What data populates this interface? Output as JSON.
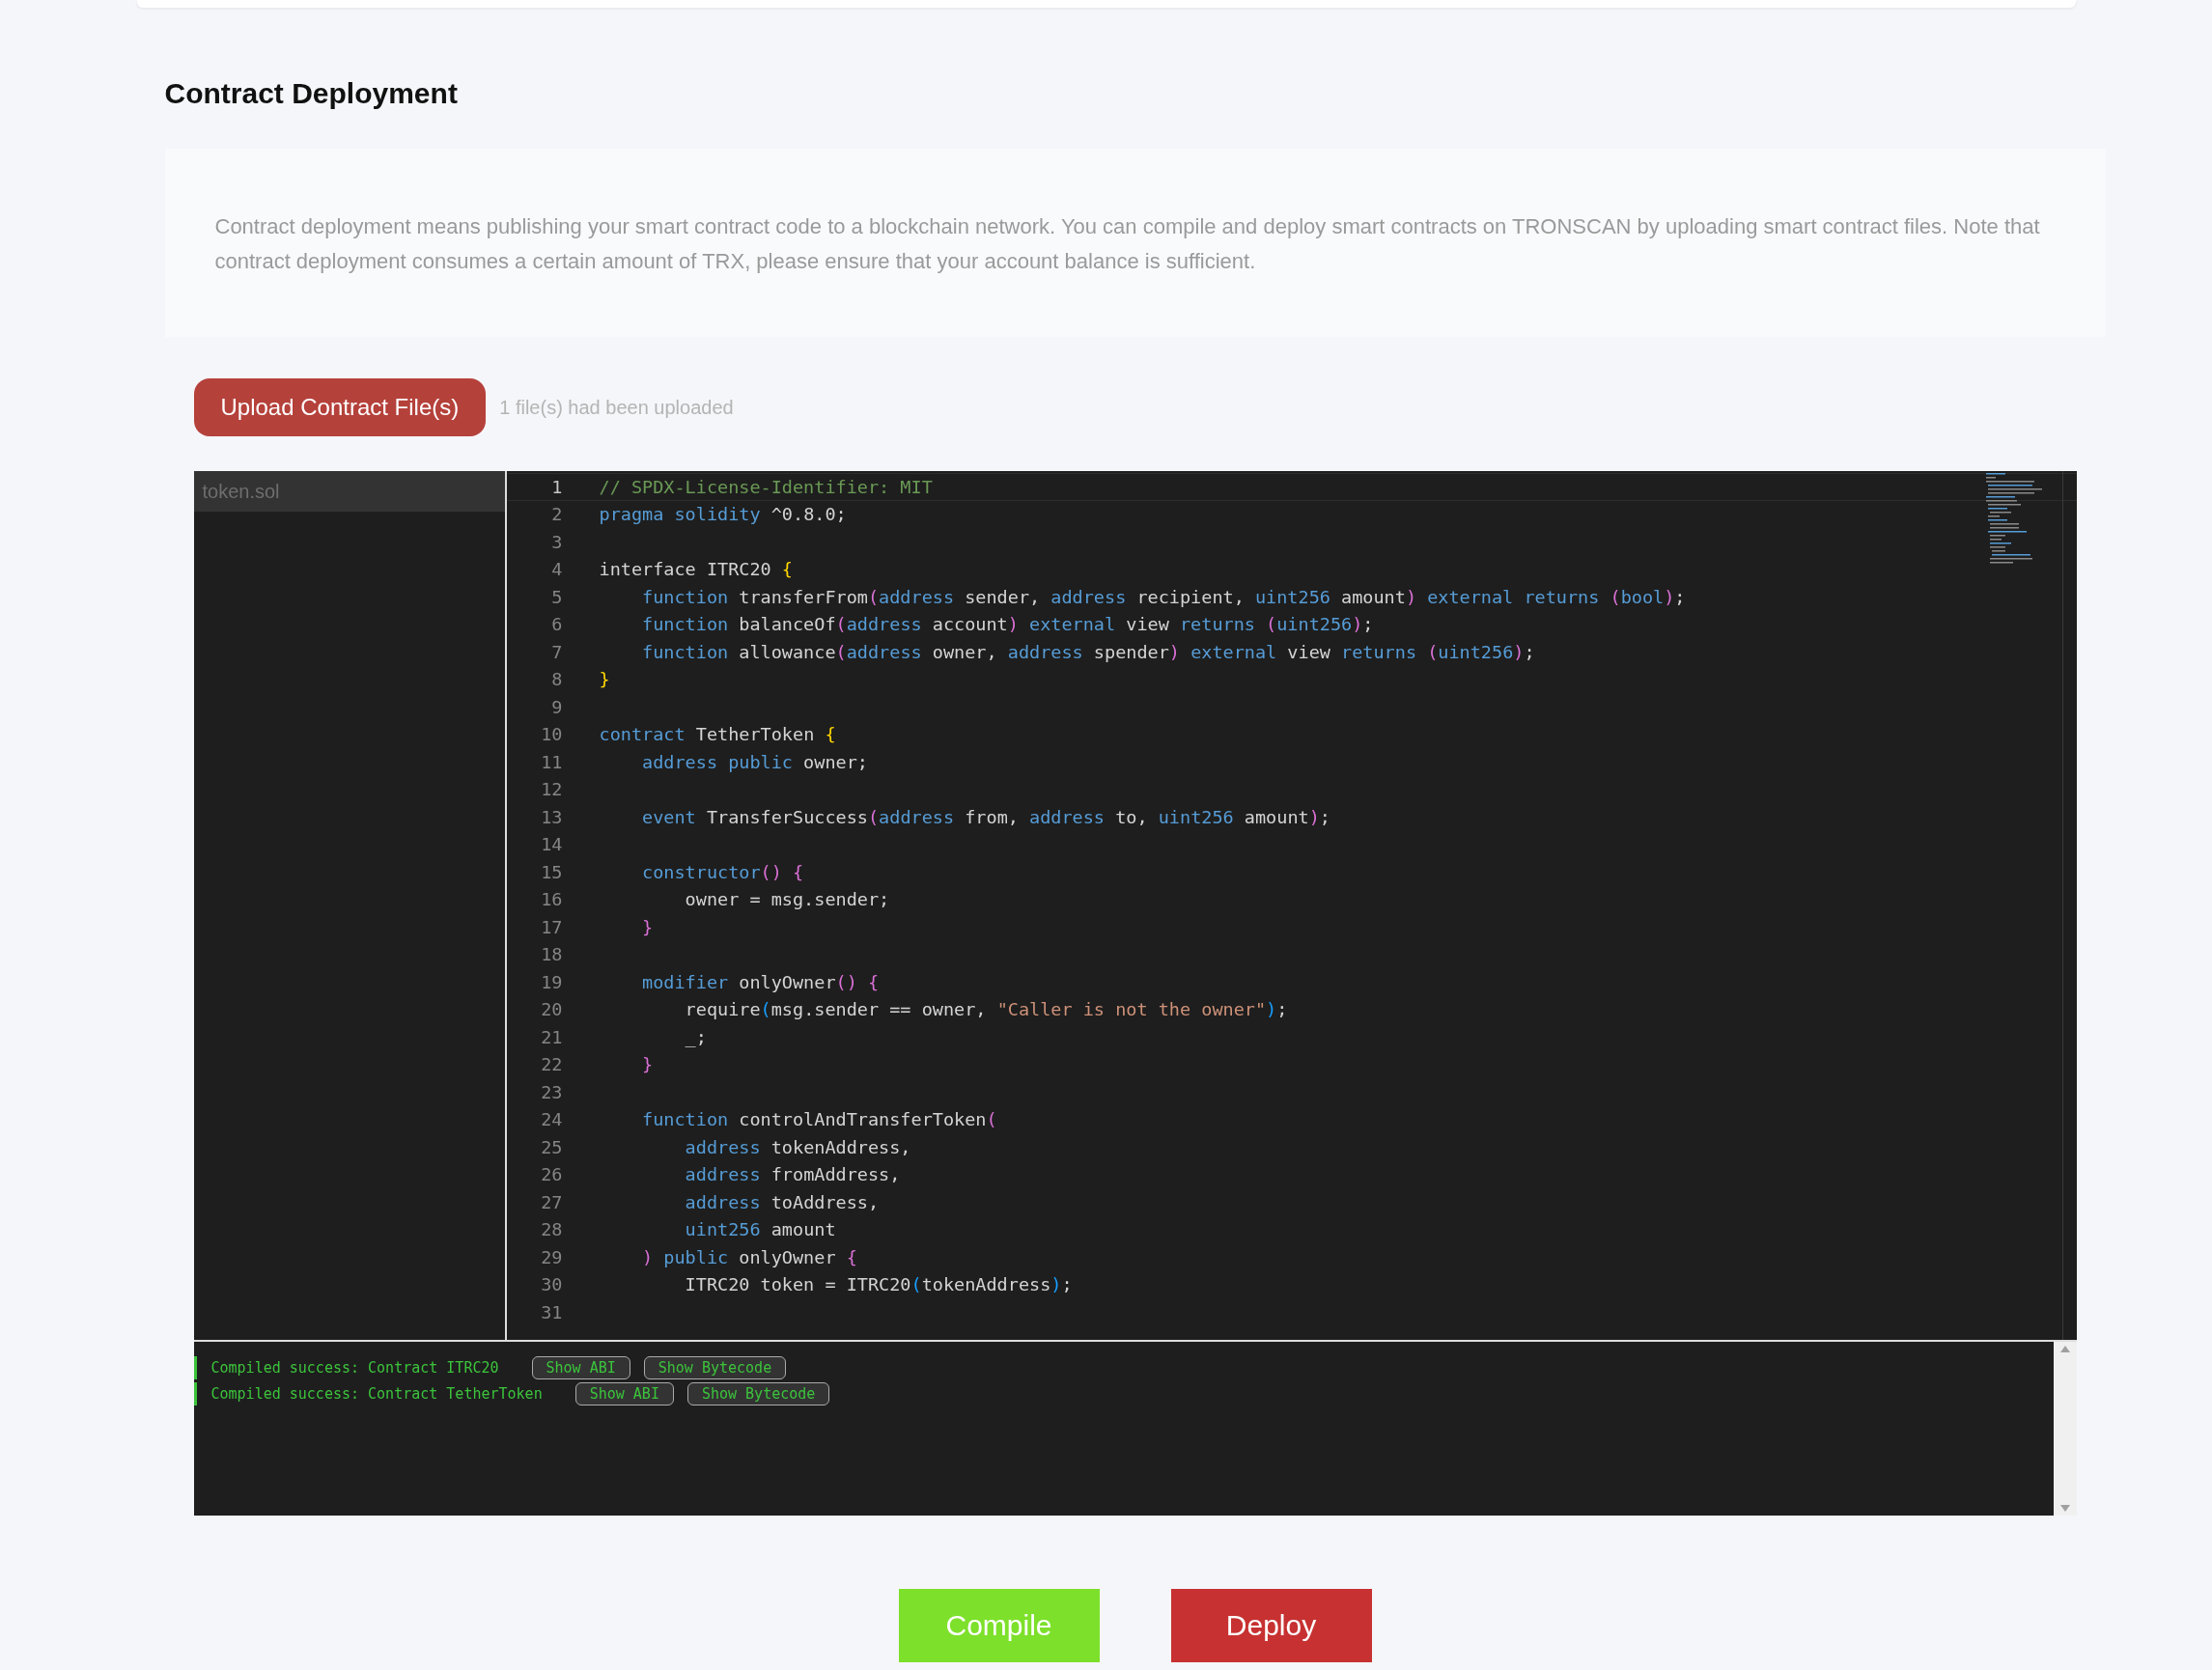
{
  "title": "Contract Deployment",
  "description": "Contract deployment means publishing your smart contract code to a blockchain network. You can compile and deploy smart contracts on TRONSCAN by uploading smart contract files. Note that contract deployment consumes a certain amount of TRX, please ensure that your account balance is sufficient.",
  "upload_button": "Upload Contract File(s)",
  "upload_status": "1 file(s) had been uploaded",
  "files": [
    {
      "name": "token.sol",
      "selected": true
    }
  ],
  "editor": {
    "lines": [
      {
        "number": "1",
        "current": true,
        "tokens": [
          {
            "t": "// SPDX-License-Identifier: MIT",
            "kind": "comment"
          }
        ]
      },
      {
        "number": "2",
        "current": false,
        "tokens": [
          {
            "t": "pragma solidity",
            "kind": "keyword"
          },
          {
            "t": " ^0.8.0;",
            "kind": "plain"
          }
        ]
      },
      {
        "number": "3",
        "current": false
      },
      {
        "number": "4",
        "current": false,
        "tokens": [
          {
            "t": "interface ITRC20 ",
            "kind": "plain"
          },
          {
            "t": "{",
            "kind": "brace1"
          }
        ]
      },
      {
        "number": "5",
        "current": false,
        "tokens": [
          {
            "t": "    function",
            "kind": "keyword"
          },
          {
            "t": " transferFrom",
            "kind": "plain"
          },
          {
            "t": "(",
            "kind": "brace2"
          },
          {
            "t": "address",
            "kind": "keyword"
          },
          {
            "t": " sender, ",
            "kind": "plain"
          },
          {
            "t": "address",
            "kind": "keyword"
          },
          {
            "t": " recipient, ",
            "kind": "plain"
          },
          {
            "t": "uint256",
            "kind": "keyword"
          },
          {
            "t": " amount",
            "kind": "plain"
          },
          {
            "t": ") ",
            "kind": "brace2"
          },
          {
            "t": "external returns ",
            "kind": "keyword"
          },
          {
            "t": "(",
            "kind": "brace2"
          },
          {
            "t": "bool",
            "kind": "keyword"
          },
          {
            "t": ")",
            "kind": "brace2"
          },
          {
            "t": ";",
            "kind": "plain"
          }
        ]
      },
      {
        "number": "6",
        "current": false,
        "tokens": [
          {
            "t": "    function",
            "kind": "keyword"
          },
          {
            "t": " balanceOf",
            "kind": "plain"
          },
          {
            "t": "(",
            "kind": "brace2"
          },
          {
            "t": "address",
            "kind": "keyword"
          },
          {
            "t": " account",
            "kind": "plain"
          },
          {
            "t": ") ",
            "kind": "brace2"
          },
          {
            "t": "external",
            "kind": "keyword"
          },
          {
            "t": " view ",
            "kind": "plain"
          },
          {
            "t": "returns ",
            "kind": "keyword"
          },
          {
            "t": "(",
            "kind": "brace2"
          },
          {
            "t": "uint256",
            "kind": "keyword"
          },
          {
            "t": ")",
            "kind": "brace2"
          },
          {
            "t": ";",
            "kind": "plain"
          }
        ]
      },
      {
        "number": "7",
        "current": false,
        "tokens": [
          {
            "t": "    function",
            "kind": "keyword"
          },
          {
            "t": " allowance",
            "kind": "plain"
          },
          {
            "t": "(",
            "kind": "brace2"
          },
          {
            "t": "address",
            "kind": "keyword"
          },
          {
            "t": " owner, ",
            "kind": "plain"
          },
          {
            "t": "address",
            "kind": "keyword"
          },
          {
            "t": " spender",
            "kind": "plain"
          },
          {
            "t": ") ",
            "kind": "brace2"
          },
          {
            "t": "external",
            "kind": "keyword"
          },
          {
            "t": " view ",
            "kind": "plain"
          },
          {
            "t": "returns ",
            "kind": "keyword"
          },
          {
            "t": "(",
            "kind": "brace2"
          },
          {
            "t": "uint256",
            "kind": "keyword"
          },
          {
            "t": ")",
            "kind": "brace2"
          },
          {
            "t": ";",
            "kind": "plain"
          }
        ]
      },
      {
        "number": "8",
        "current": false,
        "tokens": [
          {
            "t": "}",
            "kind": "brace1"
          }
        ]
      },
      {
        "number": "9",
        "current": false
      },
      {
        "number": "10",
        "current": false,
        "tokens": [
          {
            "t": "contract",
            "kind": "keyword"
          },
          {
            "t": " TetherToken ",
            "kind": "plain"
          },
          {
            "t": "{",
            "kind": "brace1"
          }
        ]
      },
      {
        "number": "11",
        "current": false,
        "tokens": [
          {
            "t": "    address public",
            "kind": "keyword"
          },
          {
            "t": " owner;",
            "kind": "plain"
          }
        ]
      },
      {
        "number": "12",
        "current": false
      },
      {
        "number": "13",
        "current": false,
        "tokens": [
          {
            "t": "    event",
            "kind": "keyword"
          },
          {
            "t": " TransferSuccess",
            "kind": "plain"
          },
          {
            "t": "(",
            "kind": "brace2"
          },
          {
            "t": "address",
            "kind": "keyword"
          },
          {
            "t": " from, ",
            "kind": "plain"
          },
          {
            "t": "address",
            "kind": "keyword"
          },
          {
            "t": " to, ",
            "kind": "plain"
          },
          {
            "t": "uint256",
            "kind": "keyword"
          },
          {
            "t": " amount",
            "kind": "plain"
          },
          {
            "t": ")",
            "kind": "brace2"
          },
          {
            "t": ";",
            "kind": "plain"
          }
        ]
      },
      {
        "number": "14",
        "current": false
      },
      {
        "number": "15",
        "current": false,
        "tokens": [
          {
            "t": "    constructor",
            "kind": "keyword"
          },
          {
            "t": "() {",
            "kind": "brace2"
          }
        ]
      },
      {
        "number": "16",
        "current": false,
        "tokens": [
          {
            "t": "        owner = msg.sender;",
            "kind": "plain"
          }
        ]
      },
      {
        "number": "17",
        "current": false,
        "tokens": [
          {
            "t": "    }",
            "kind": "brace2"
          }
        ]
      },
      {
        "number": "18",
        "current": false
      },
      {
        "number": "19",
        "current": false,
        "tokens": [
          {
            "t": "    modifier",
            "kind": "keyword"
          },
          {
            "t": " onlyOwner",
            "kind": "plain"
          },
          {
            "t": "() {",
            "kind": "brace2"
          }
        ]
      },
      {
        "number": "20",
        "current": false,
        "tokens": [
          {
            "t": "        require",
            "kind": "plain"
          },
          {
            "t": "(",
            "kind": "brace3"
          },
          {
            "t": "msg.sender == owner, ",
            "kind": "plain"
          },
          {
            "t": "\"Caller is not the owner\"",
            "kind": "string"
          },
          {
            "t": ")",
            "kind": "brace3"
          },
          {
            "t": ";",
            "kind": "plain"
          }
        ]
      },
      {
        "number": "21",
        "current": false,
        "tokens": [
          {
            "t": "        _;",
            "kind": "plain"
          }
        ]
      },
      {
        "number": "22",
        "current": false,
        "tokens": [
          {
            "t": "    }",
            "kind": "brace2"
          }
        ]
      },
      {
        "number": "23",
        "current": false
      },
      {
        "number": "24",
        "current": false,
        "tokens": [
          {
            "t": "    function",
            "kind": "keyword"
          },
          {
            "t": " controlAndTransferToken",
            "kind": "plain"
          },
          {
            "t": "(",
            "kind": "brace2"
          }
        ]
      },
      {
        "number": "25",
        "current": false,
        "tokens": [
          {
            "t": "        address",
            "kind": "keyword"
          },
          {
            "t": " tokenAddress,",
            "kind": "plain"
          }
        ]
      },
      {
        "number": "26",
        "current": false,
        "tokens": [
          {
            "t": "        address",
            "kind": "keyword"
          },
          {
            "t": " fromAddress,",
            "kind": "plain"
          }
        ]
      },
      {
        "number": "27",
        "current": false,
        "tokens": [
          {
            "t": "        address",
            "kind": "keyword"
          },
          {
            "t": " toAddress,",
            "kind": "plain"
          }
        ]
      },
      {
        "number": "28",
        "current": false,
        "tokens": [
          {
            "t": "        uint256",
            "kind": "keyword"
          },
          {
            "t": " amount",
            "kind": "plain"
          }
        ]
      },
      {
        "number": "29",
        "current": false,
        "tokens": [
          {
            "t": "    ) ",
            "kind": "brace2"
          },
          {
            "t": "public",
            "kind": "keyword"
          },
          {
            "t": " onlyOwner ",
            "kind": "plain"
          },
          {
            "t": "{",
            "kind": "brace2"
          }
        ]
      },
      {
        "number": "30",
        "current": false,
        "tokens": [
          {
            "t": "        ITRC20 token = ITRC20",
            "kind": "plain"
          },
          {
            "t": "(",
            "kind": "brace3"
          },
          {
            "t": "tokenAddress",
            "kind": "plain"
          },
          {
            "t": ")",
            "kind": "brace3"
          },
          {
            "t": ";",
            "kind": "plain"
          }
        ]
      },
      {
        "number": "31",
        "current": false
      }
    ]
  },
  "console": [
    {
      "message": "Compiled success: Contract ITRC20",
      "buttons": [
        "Show ABI",
        "Show Bytecode"
      ]
    },
    {
      "message": "Compiled success: Contract TetherToken",
      "buttons": [
        "Show ABI",
        "Show Bytecode"
      ]
    }
  ],
  "actions": [
    {
      "label": "Compile",
      "kind": "compile"
    },
    {
      "label": "Deploy",
      "kind": "deploy"
    }
  ]
}
